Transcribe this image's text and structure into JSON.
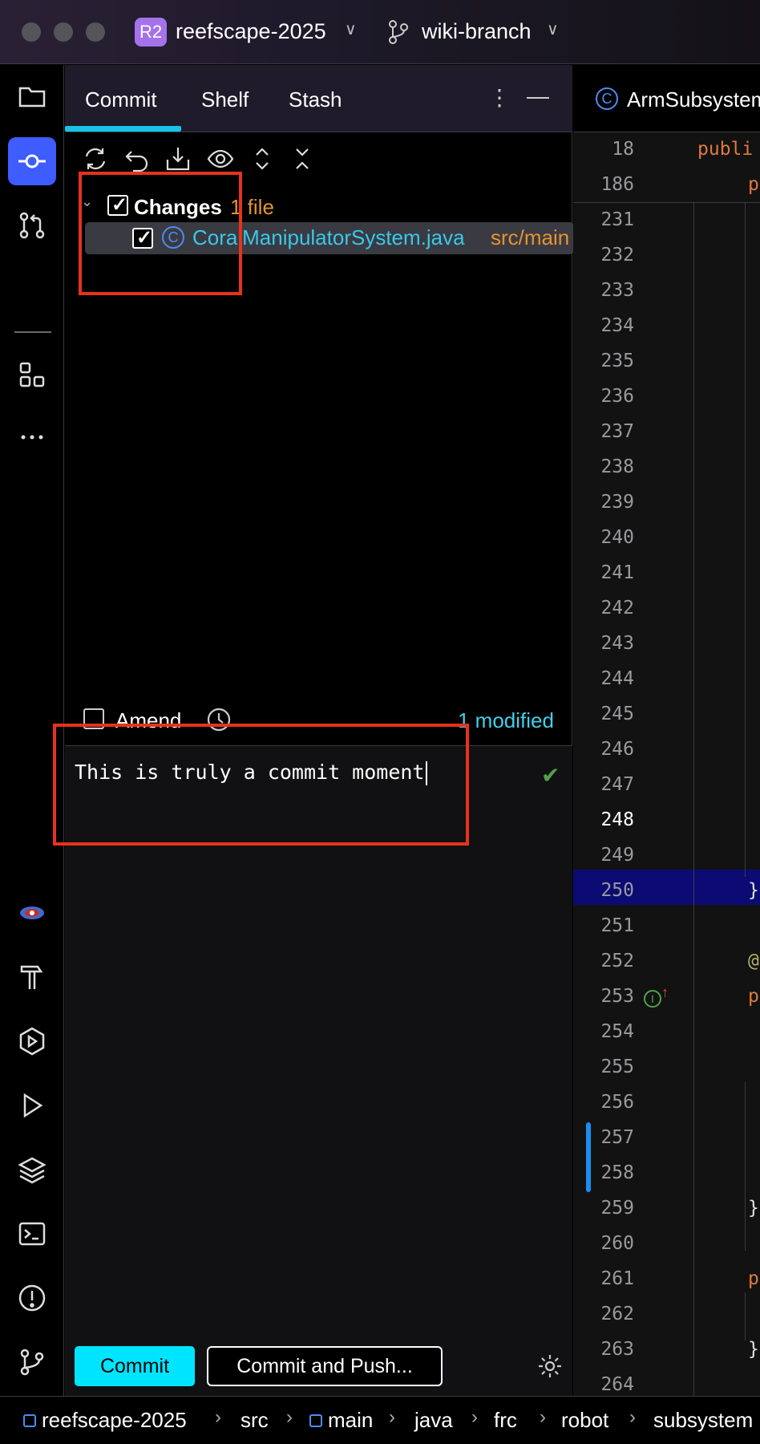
{
  "titlebar": {
    "project_badge": "R2",
    "project_name": "reefscape-2025",
    "branch_name": "wiki-branch"
  },
  "toolstrip": {
    "items": [
      "folder-icon",
      "commit-icon",
      "pull-request-icon",
      "structure-icon",
      "more-icon",
      "plugin-icon",
      "build-icon",
      "services-icon",
      "run-icon",
      "layers-icon",
      "terminal-icon",
      "problems-icon",
      "git-icon"
    ]
  },
  "panel": {
    "tabs": [
      "Commit",
      "Shelf",
      "Stash"
    ],
    "active_tab": "Commit",
    "changes_label": "Changes",
    "changes_count": "1 file",
    "file_name": "CoralManipulatorSystem.java",
    "file_path": "src/main",
    "amend_label": "Amend",
    "modified_label": "1 modified",
    "commit_message": "This is truly a commit moment",
    "commit_button": "Commit",
    "commit_push_button": "Commit and Push..."
  },
  "editor": {
    "tab_label": "ArmSubsystem",
    "sticky_lines": [
      {
        "num": "18",
        "code": "publi"
      },
      {
        "num": "186",
        "code": "p"
      }
    ],
    "line_numbers": [
      "231",
      "232",
      "233",
      "234",
      "235",
      "236",
      "237",
      "238",
      "239",
      "240",
      "241",
      "242",
      "243",
      "244",
      "245",
      "246",
      "247",
      "248",
      "249",
      "250",
      "251",
      "252",
      "253",
      "254",
      "255",
      "256",
      "257",
      "258",
      "259",
      "260",
      "261",
      "262",
      "263",
      "264"
    ],
    "current_line": "248",
    "code_fragments": [
      {
        "line": "250",
        "text": "}"
      },
      {
        "line": "252",
        "text": "@"
      },
      {
        "line": "253",
        "text": "p"
      },
      {
        "line": "259",
        "text": "}"
      },
      {
        "line": "261",
        "text": "p"
      },
      {
        "line": "263",
        "text": "}"
      }
    ]
  },
  "breadcrumbs": [
    "reefscape-2025",
    "src",
    "main",
    "java",
    "frc",
    "robot",
    "subsystem"
  ]
}
